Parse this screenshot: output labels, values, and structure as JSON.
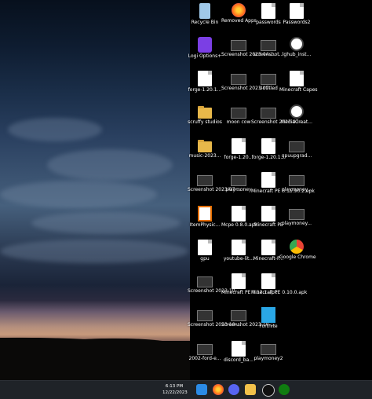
{
  "desktop": {
    "icons": [
      {
        "label": "Recycle Bin",
        "icon": "recycle-bin-icon"
      },
      {
        "label": "Removed Apps",
        "icon": "browser-icon"
      },
      {
        "label": "passwords",
        "icon": "document-icon"
      },
      {
        "label": "Passwords2",
        "icon": "document-icon"
      },
      {
        "label": "Logi Options+",
        "icon": "logi-icon"
      },
      {
        "label": "Screenshot 2023-04-...",
        "icon": "image-icon"
      },
      {
        "label": "screenshot...",
        "icon": "image-icon"
      },
      {
        "label": "lghub_inst...",
        "icon": "installer-icon"
      },
      {
        "label": "forge-1.20.1...",
        "icon": "document-icon"
      },
      {
        "label": "Screenshot 2023-07-...",
        "icon": "image-icon"
      },
      {
        "label": "Untitled",
        "icon": "image-icon"
      },
      {
        "label": "Minecraft Capes",
        "icon": "document-icon"
      },
      {
        "label": "scruffy studios",
        "icon": "folder-icon"
      },
      {
        "label": "moon cow",
        "icon": "image-icon"
      },
      {
        "label": "Screenshot 2023-07-...",
        "icon": "image-icon"
      },
      {
        "label": "MediaCreat...",
        "icon": "installer-icon"
      },
      {
        "label": "music-2023...",
        "icon": "folder-icon"
      },
      {
        "label": "forge-1.20...",
        "icon": "document-icon"
      },
      {
        "label": "forge-1.20.1...",
        "icon": "document-icon"
      },
      {
        "label": "gpuupgrad...",
        "icon": "image-icon"
      },
      {
        "label": "Screenshot 2023-07-...",
        "icon": "image-icon"
      },
      {
        "label": "playmoney",
        "icon": "image-icon"
      },
      {
        "label": "Minecraft PE 0.15.90.2.apk",
        "icon": "document-icon"
      },
      {
        "label": "playmoney...",
        "icon": "image-icon"
      },
      {
        "label": "ItemPhysic...",
        "icon": "java-icon"
      },
      {
        "label": "Mcpe 0.8.0.apk",
        "icon": "document-icon"
      },
      {
        "label": "Minecraft PE",
        "icon": "document-icon"
      },
      {
        "label": "playmoney...",
        "icon": "image-icon"
      },
      {
        "label": "gpu",
        "icon": "document-icon"
      },
      {
        "label": "youtube-lit...",
        "icon": "document-icon"
      },
      {
        "label": "Minecraft-P...",
        "icon": "document-icon"
      },
      {
        "label": "Google Chrome",
        "icon": "chrome-icon"
      },
      {
        "label": "Screenshot 2023-10-...",
        "icon": "image-icon"
      },
      {
        "label": "Minecraft PE 0.12.1.apk",
        "icon": "document-icon"
      },
      {
        "label": "Minecraft PE 0.10.0.apk",
        "icon": "document-icon"
      },
      {
        "label": "",
        "icon": "empty"
      },
      {
        "label": "Screenshot 2023-10-...",
        "icon": "image-icon"
      },
      {
        "label": "Screenshot 2023-10-...",
        "icon": "image-icon"
      },
      {
        "label": "Fortnite",
        "icon": "fortnite-icon"
      },
      {
        "label": "",
        "icon": "empty"
      },
      {
        "label": "2002-ford-e...",
        "icon": "image-icon"
      },
      {
        "label": "discord_ba...",
        "icon": "document-icon"
      },
      {
        "label": "playmoney2",
        "icon": "image-icon"
      },
      {
        "label": "",
        "icon": "empty"
      }
    ]
  },
  "taskbar": {
    "clock_time": "6:13 PM",
    "clock_date": "12/22/2023",
    "apps": [
      "windows-start-icon",
      "firefox-icon",
      "discord-icon",
      "file-explorer-icon",
      "steam-icon",
      "xbox-icon"
    ]
  }
}
